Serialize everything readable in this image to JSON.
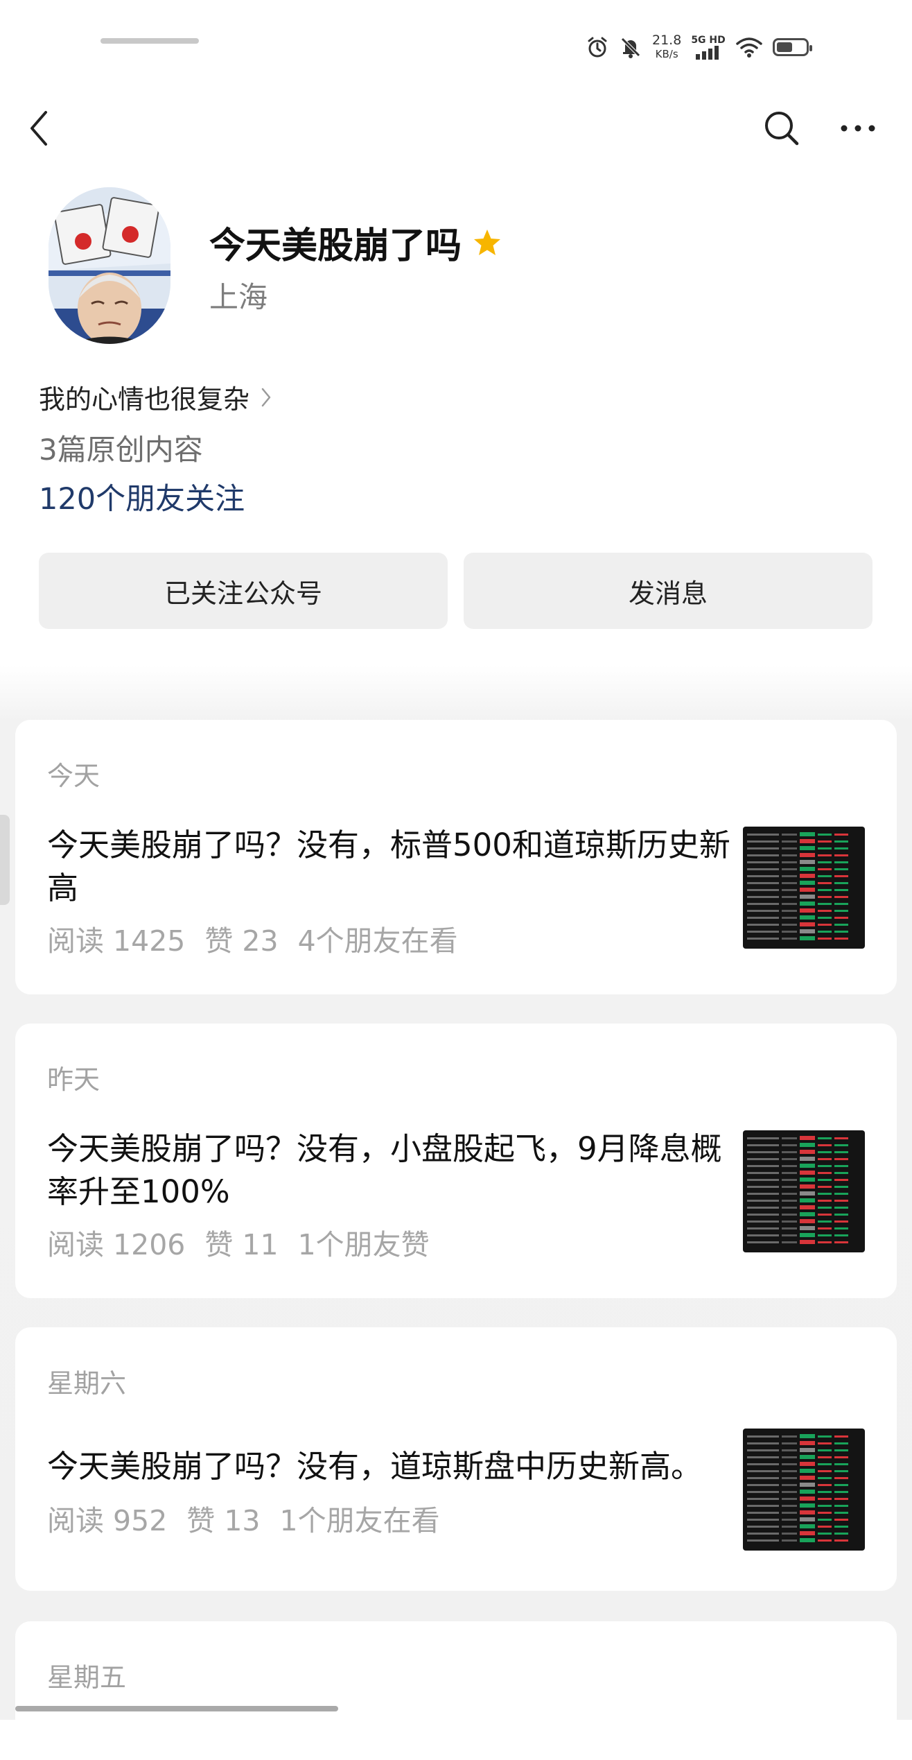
{
  "status_bar": {
    "net_speed": "21.8",
    "net_unit": "KB/s",
    "signal_label": "5G HD",
    "icons": [
      "alarm-icon",
      "mute-bell-icon",
      "signal-bars-icon",
      "wifi-icon",
      "battery-icon"
    ],
    "battery_level": 0.55
  },
  "nav": {
    "back_icon": "chevron-left-icon",
    "search_icon": "search-icon",
    "more_icon": "more-dots-icon"
  },
  "profile": {
    "name": "今天美股崩了吗",
    "star_icon": "star-icon",
    "star_color": "#f7b500",
    "location": "上海",
    "bio": "我的心情也很复杂",
    "posts_count_text": "3篇原创内容",
    "friends_follow_text": "120个朋友关注",
    "link_color": "#203a6a"
  },
  "actions": {
    "followed_label": "已关注公众号",
    "message_label": "发消息"
  },
  "articles": [
    {
      "date": "今天",
      "title": "今天美股崩了吗？没有，标普500和道琼斯历史新高",
      "reads": "阅读 1425",
      "likes": "赞 23",
      "social": "4个朋友在看"
    },
    {
      "date": "昨天",
      "title": "今天美股崩了吗？没有，小盘股起飞，9月降息概率升至100%",
      "reads": "阅读 1206",
      "likes": "赞 11",
      "social": "1个朋友赞"
    },
    {
      "date": "星期六",
      "title": "今天美股崩了吗？没有，道琼斯盘中历史新高。",
      "reads": "阅读 952",
      "likes": "赞 13",
      "social": "1个朋友在看"
    },
    {
      "date": "星期五"
    }
  ]
}
